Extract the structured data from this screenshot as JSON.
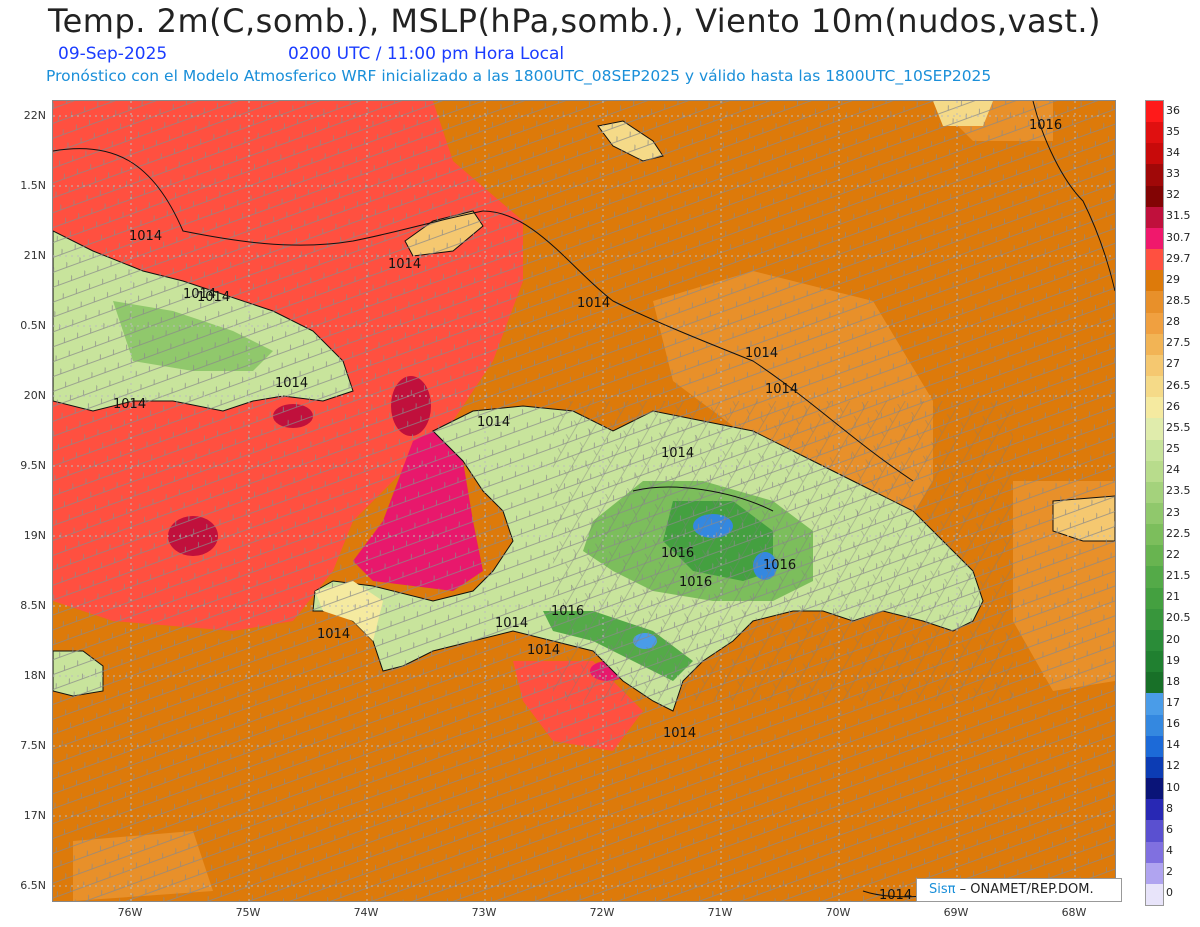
{
  "header": {
    "title": "Temp. 2m(C,somb.), MSLP(hPa,somb.), Viento 10m(nudos,vast.)",
    "date": "09-Sep-2025",
    "time": "0200 UTC / 11:00 pm Hora Local",
    "subtitle": "Pronóstico con el Modelo Atmosferico WRF inicializado a las 1800UTC_08SEP2025 y válido hasta las  1800UTC_10SEP2025"
  },
  "axes": {
    "lat_labels": [
      "22N",
      "1.5N",
      "21N",
      "0.5N",
      "20N",
      "9.5N",
      "19N",
      "8.5N",
      "18N",
      "7.5N",
      "17N",
      "6.5N"
    ],
    "lon_labels": [
      "76W",
      "75W",
      "74W",
      "73W",
      "72W",
      "71W",
      "70W",
      "69W",
      "68W"
    ]
  },
  "isobar_labels": [
    "1016",
    "1014",
    "1014",
    "1014",
    "1014",
    "1014",
    "1014",
    "1014",
    "1014",
    "1014",
    "1014",
    "1014",
    "1014",
    "1016",
    "1016",
    "1016",
    "1016",
    "1014",
    "1014",
    "1014",
    "1014"
  ],
  "colorbar": {
    "labels": [
      "36",
      "35",
      "34",
      "33",
      "32",
      "31.5",
      "30.7",
      "29.7",
      "29",
      "28.5",
      "28",
      "27.5",
      "27",
      "26.5",
      "26",
      "25.5",
      "25",
      "24",
      "23.5",
      "23",
      "22.5",
      "22",
      "21.5",
      "21",
      "20.5",
      "20",
      "19",
      "18",
      "17",
      "16",
      "14",
      "12",
      "10",
      "8",
      "6",
      "4",
      "2",
      "0"
    ],
    "colors": [
      "#ff1a1a",
      "#e01010",
      "#c80a0a",
      "#a00808",
      "#820404",
      "#c0103c",
      "#f0186c",
      "#ff5040",
      "#dd7a0a",
      "#e8902a",
      "#f0a040",
      "#f2b455",
      "#f5c870",
      "#f5da88",
      "#f5eaa0",
      "#e0ecac",
      "#c8e49c",
      "#b8dc8c",
      "#a4d27c",
      "#90c86c",
      "#7cbe5c",
      "#68b450",
      "#54aa48",
      "#44a040",
      "#38963c",
      "#2a8c38",
      "#208030",
      "#187028",
      "#4a9ce8",
      "#3488e0",
      "#1c6ad8",
      "#0c3cb4",
      "#0a1478",
      "#2828b4",
      "#5a50d0",
      "#8070e0",
      "#b0a4f0",
      "#e8e4fa"
    ]
  },
  "credit": {
    "brand": "Sisπ",
    "text": "– ONAMET/REP.DOM."
  }
}
